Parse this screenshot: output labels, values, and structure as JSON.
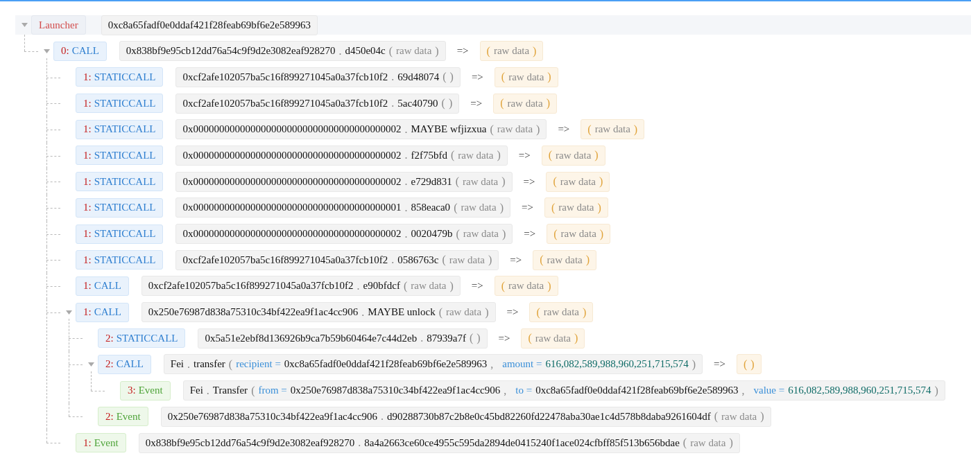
{
  "root": {
    "label": "Launcher",
    "expanded": true,
    "address": "0xc8a65fadf0e0ddaf421f28feab69bf6e2e589963",
    "children": [
      {
        "index": "0:",
        "type": "CALL",
        "kind": "call",
        "expanded": true,
        "call": [
          {
            "kind": "text",
            "text": "0x838bf9e95cb12dd76a54c9f9d2e3082eaf928270"
          },
          {
            "kind": "punct",
            "text": "."
          },
          {
            "kind": "text",
            "text": "d450e04c"
          },
          {
            "kind": "punct",
            "text": "("
          },
          {
            "kind": "muted",
            "text": "raw data"
          },
          {
            "kind": "punct",
            "text": ")"
          }
        ],
        "arrow": "=>",
        "returns": [
          {
            "kind": "punct",
            "text": "("
          },
          {
            "kind": "muted",
            "text": "raw data"
          },
          {
            "kind": "punct",
            "text": ")"
          }
        ],
        "children": [
          {
            "index": "1:",
            "type": "STATICCALL",
            "kind": "call",
            "call": [
              {
                "kind": "text",
                "text": "0xcf2afe102057ba5c16f899271045a0a37fcb10f2"
              },
              {
                "kind": "punct",
                "text": "."
              },
              {
                "kind": "text",
                "text": "69d48074"
              },
              {
                "kind": "punct",
                "text": "("
              },
              {
                "kind": "punct",
                "text": ")"
              }
            ],
            "arrow": "=>",
            "returns": [
              {
                "kind": "punct",
                "text": "("
              },
              {
                "kind": "muted",
                "text": "raw data"
              },
              {
                "kind": "punct",
                "text": ")"
              }
            ]
          },
          {
            "index": "1:",
            "type": "STATICCALL",
            "kind": "call",
            "call": [
              {
                "kind": "text",
                "text": "0xcf2afe102057ba5c16f899271045a0a37fcb10f2"
              },
              {
                "kind": "punct",
                "text": "."
              },
              {
                "kind": "text",
                "text": "5ac40790"
              },
              {
                "kind": "punct",
                "text": "("
              },
              {
                "kind": "punct",
                "text": ")"
              }
            ],
            "arrow": "=>",
            "returns": [
              {
                "kind": "punct",
                "text": "("
              },
              {
                "kind": "muted",
                "text": "raw data"
              },
              {
                "kind": "punct",
                "text": ")"
              }
            ]
          },
          {
            "index": "1:",
            "type": "STATICCALL",
            "kind": "call",
            "call": [
              {
                "kind": "text",
                "text": "0x0000000000000000000000000000000000000002"
              },
              {
                "kind": "punct",
                "text": "."
              },
              {
                "kind": "text",
                "text": "MAYBE wfjizxua"
              },
              {
                "kind": "punct",
                "text": "("
              },
              {
                "kind": "muted",
                "text": "raw data"
              },
              {
                "kind": "punct",
                "text": ")"
              }
            ],
            "arrow": "=>",
            "returns": [
              {
                "kind": "punct",
                "text": "("
              },
              {
                "kind": "muted",
                "text": "raw data"
              },
              {
                "kind": "punct",
                "text": ")"
              }
            ]
          },
          {
            "index": "1:",
            "type": "STATICCALL",
            "kind": "call",
            "call": [
              {
                "kind": "text",
                "text": "0x0000000000000000000000000000000000000002"
              },
              {
                "kind": "punct",
                "text": "."
              },
              {
                "kind": "text",
                "text": "f2f75bfd"
              },
              {
                "kind": "punct",
                "text": "("
              },
              {
                "kind": "muted",
                "text": "raw data"
              },
              {
                "kind": "punct",
                "text": ")"
              }
            ],
            "arrow": "=>",
            "returns": [
              {
                "kind": "punct",
                "text": "("
              },
              {
                "kind": "muted",
                "text": "raw data"
              },
              {
                "kind": "punct",
                "text": ")"
              }
            ]
          },
          {
            "index": "1:",
            "type": "STATICCALL",
            "kind": "call",
            "call": [
              {
                "kind": "text",
                "text": "0x0000000000000000000000000000000000000002"
              },
              {
                "kind": "punct",
                "text": "."
              },
              {
                "kind": "text",
                "text": "e729d831"
              },
              {
                "kind": "punct",
                "text": "("
              },
              {
                "kind": "muted",
                "text": "raw data"
              },
              {
                "kind": "punct",
                "text": ")"
              }
            ],
            "arrow": "=>",
            "returns": [
              {
                "kind": "punct",
                "text": "("
              },
              {
                "kind": "muted",
                "text": "raw data"
              },
              {
                "kind": "punct",
                "text": ")"
              }
            ]
          },
          {
            "index": "1:",
            "type": "STATICCALL",
            "kind": "call",
            "call": [
              {
                "kind": "text",
                "text": "0x0000000000000000000000000000000000000001"
              },
              {
                "kind": "punct",
                "text": "."
              },
              {
                "kind": "text",
                "text": "858eaca0"
              },
              {
                "kind": "punct",
                "text": "("
              },
              {
                "kind": "muted",
                "text": "raw data"
              },
              {
                "kind": "punct",
                "text": ")"
              }
            ],
            "arrow": "=>",
            "returns": [
              {
                "kind": "punct",
                "text": "("
              },
              {
                "kind": "muted",
                "text": "raw data"
              },
              {
                "kind": "punct",
                "text": ")"
              }
            ]
          },
          {
            "index": "1:",
            "type": "STATICCALL",
            "kind": "call",
            "call": [
              {
                "kind": "text",
                "text": "0x0000000000000000000000000000000000000002"
              },
              {
                "kind": "punct",
                "text": "."
              },
              {
                "kind": "text",
                "text": "0020479b"
              },
              {
                "kind": "punct",
                "text": "("
              },
              {
                "kind": "muted",
                "text": "raw data"
              },
              {
                "kind": "punct",
                "text": ")"
              }
            ],
            "arrow": "=>",
            "returns": [
              {
                "kind": "punct",
                "text": "("
              },
              {
                "kind": "muted",
                "text": "raw data"
              },
              {
                "kind": "punct",
                "text": ")"
              }
            ]
          },
          {
            "index": "1:",
            "type": "STATICCALL",
            "kind": "call",
            "call": [
              {
                "kind": "text",
                "text": "0xcf2afe102057ba5c16f899271045a0a37fcb10f2"
              },
              {
                "kind": "punct",
                "text": "."
              },
              {
                "kind": "text",
                "text": "0586763c"
              },
              {
                "kind": "punct",
                "text": "("
              },
              {
                "kind": "muted",
                "text": "raw data"
              },
              {
                "kind": "punct",
                "text": ")"
              }
            ],
            "arrow": "=>",
            "returns": [
              {
                "kind": "punct",
                "text": "("
              },
              {
                "kind": "muted",
                "text": "raw data"
              },
              {
                "kind": "punct",
                "text": ")"
              }
            ]
          },
          {
            "index": "1:",
            "type": "CALL",
            "kind": "call",
            "call": [
              {
                "kind": "text",
                "text": "0xcf2afe102057ba5c16f899271045a0a37fcb10f2"
              },
              {
                "kind": "punct",
                "text": "."
              },
              {
                "kind": "text",
                "text": "e90bfdcf"
              },
              {
                "kind": "punct",
                "text": "("
              },
              {
                "kind": "muted",
                "text": "raw data"
              },
              {
                "kind": "punct",
                "text": ")"
              }
            ],
            "arrow": "=>",
            "returns": [
              {
                "kind": "punct",
                "text": "("
              },
              {
                "kind": "muted",
                "text": "raw data"
              },
              {
                "kind": "punct",
                "text": ")"
              }
            ]
          },
          {
            "index": "1:",
            "type": "CALL",
            "kind": "call",
            "expanded": true,
            "call": [
              {
                "kind": "text",
                "text": "0x250e76987d838a75310c34bf422ea9f1ac4cc906"
              },
              {
                "kind": "punct",
                "text": "."
              },
              {
                "kind": "text",
                "text": "MAYBE unlock"
              },
              {
                "kind": "punct",
                "text": "("
              },
              {
                "kind": "muted",
                "text": "raw data"
              },
              {
                "kind": "punct",
                "text": ")"
              }
            ],
            "arrow": "=>",
            "returns": [
              {
                "kind": "punct",
                "text": "("
              },
              {
                "kind": "muted",
                "text": "raw data"
              },
              {
                "kind": "punct",
                "text": ")"
              }
            ],
            "children": [
              {
                "index": "2:",
                "type": "STATICCALL",
                "kind": "call",
                "call": [
                  {
                    "kind": "text",
                    "text": "0x5a51e2ebf8d136926b9ca7b59b60464e7c44d2eb"
                  },
                  {
                    "kind": "punct",
                    "text": "."
                  },
                  {
                    "kind": "text",
                    "text": "87939a7f"
                  },
                  {
                    "kind": "punct",
                    "text": "("
                  },
                  {
                    "kind": "punct",
                    "text": ")"
                  }
                ],
                "arrow": "=>",
                "returns": [
                  {
                    "kind": "punct",
                    "text": "("
                  },
                  {
                    "kind": "muted",
                    "text": "raw data"
                  },
                  {
                    "kind": "punct",
                    "text": ")"
                  }
                ]
              },
              {
                "index": "2:",
                "type": "CALL",
                "kind": "call",
                "expanded": true,
                "call": [
                  {
                    "kind": "text",
                    "text": "Fei"
                  },
                  {
                    "kind": "punct",
                    "text": "."
                  },
                  {
                    "kind": "text",
                    "text": "transfer"
                  },
                  {
                    "kind": "punct",
                    "text": "("
                  },
                  {
                    "kind": "param",
                    "text": "recipient ="
                  },
                  {
                    "kind": "text",
                    "text": "0xc8a65fadf0e0ddaf421f28feab69bf6e2e589963"
                  },
                  {
                    "kind": "punct",
                    "text": ","
                  },
                  {
                    "kind": "param",
                    "text": "amount ="
                  },
                  {
                    "kind": "number",
                    "text": "616,082,589,988,960,251,715,574"
                  },
                  {
                    "kind": "punct",
                    "text": ")"
                  }
                ],
                "arrow": "=>",
                "returns": [
                  {
                    "kind": "punct",
                    "text": "("
                  },
                  {
                    "kind": "punct",
                    "text": ")"
                  }
                ],
                "children": [
                  {
                    "index": "3:",
                    "type": "Event",
                    "kind": "event",
                    "call": [
                      {
                        "kind": "text",
                        "text": "Fei"
                      },
                      {
                        "kind": "punct",
                        "text": "."
                      },
                      {
                        "kind": "text",
                        "text": "Transfer"
                      },
                      {
                        "kind": "punct",
                        "text": "("
                      },
                      {
                        "kind": "param",
                        "text": "from ="
                      },
                      {
                        "kind": "text",
                        "text": "0x250e76987d838a75310c34bf422ea9f1ac4cc906"
                      },
                      {
                        "kind": "punct",
                        "text": ","
                      },
                      {
                        "kind": "param",
                        "text": "to ="
                      },
                      {
                        "kind": "text",
                        "text": "0xc8a65fadf0e0ddaf421f28feab69bf6e2e589963"
                      },
                      {
                        "kind": "punct",
                        "text": ","
                      },
                      {
                        "kind": "param",
                        "text": "value ="
                      },
                      {
                        "kind": "number",
                        "text": "616,082,589,988,960,251,715,574"
                      },
                      {
                        "kind": "punct",
                        "text": ")"
                      }
                    ]
                  }
                ]
              },
              {
                "index": "2:",
                "type": "Event",
                "kind": "event",
                "call": [
                  {
                    "kind": "text",
                    "text": "0x250e76987d838a75310c34bf422ea9f1ac4cc906"
                  },
                  {
                    "kind": "punct",
                    "text": "."
                  },
                  {
                    "kind": "text",
                    "text": "d90288730b87c2b8e0c45bd82260fd22478aba30ae1c4d578b8daba9261604df"
                  },
                  {
                    "kind": "punct",
                    "text": "("
                  },
                  {
                    "kind": "muted",
                    "text": "raw data"
                  },
                  {
                    "kind": "punct",
                    "text": ")"
                  }
                ]
              }
            ]
          },
          {
            "index": "1:",
            "type": "Event",
            "kind": "event",
            "call": [
              {
                "kind": "text",
                "text": "0x838bf9e95cb12dd76a54c9f9d2e3082eaf928270"
              },
              {
                "kind": "punct",
                "text": "."
              },
              {
                "kind": "text",
                "text": "8a4a2663ce60ce4955c595da2894de0415240f1ace024cfbff85f513b656bdae"
              },
              {
                "kind": "punct",
                "text": "("
              },
              {
                "kind": "muted",
                "text": "raw data"
              },
              {
                "kind": "punct",
                "text": ")"
              }
            ]
          }
        ]
      }
    ]
  }
}
